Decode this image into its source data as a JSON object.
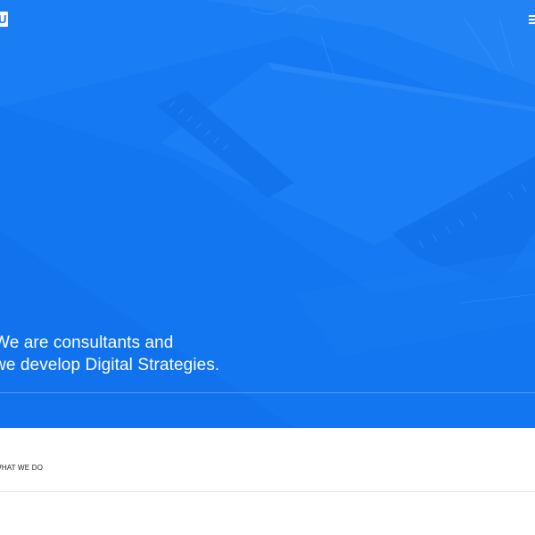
{
  "header": {
    "logo_letter": "U",
    "menu_icon": "hamburger-menu-icon"
  },
  "hero": {
    "background_color": "#1479f2",
    "headline_line_1": "We are consultants and",
    "headline_line_2": "we develop Digital Strategies."
  },
  "section": {
    "label": "WHAT WE DO"
  }
}
